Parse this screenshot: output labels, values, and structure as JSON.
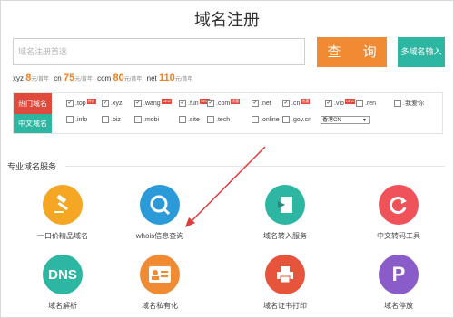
{
  "title": "域名注册",
  "search": {
    "placeholder": "域名注册首选"
  },
  "buttons": {
    "query": "查 询",
    "multi": "多域名输入"
  },
  "prices": [
    {
      "ext": "xyz",
      "price": "8",
      "unit": "元/首年"
    },
    {
      "ext": "cn",
      "price": "75",
      "unit": "元/首年"
    },
    {
      "ext": "com",
      "price": "80",
      "unit": "元/首年"
    },
    {
      "ext": "net",
      "price": "110",
      "unit": "元/首年"
    }
  ],
  "categories": {
    "hot": "热门域名",
    "chinese": "中文域名"
  },
  "options_row1": [
    {
      "label": ".top",
      "checked": true,
      "tag": "特价"
    },
    {
      "label": ".xyz",
      "checked": true,
      "tag": ""
    },
    {
      "label": ".wang",
      "checked": true,
      "tag": "NEW"
    },
    {
      "label": ".fun",
      "checked": true,
      "tag": "NEW"
    },
    {
      "label": ".com",
      "checked": true,
      "tag": "优惠"
    },
    {
      "label": ".net",
      "checked": true,
      "tag": ""
    },
    {
      "label": ".cn",
      "checked": true,
      "tag": "优惠"
    },
    {
      "label": ".vip",
      "checked": true,
      "tag": "NEW"
    },
    {
      "label": ".ren",
      "checked": false,
      "tag": ""
    },
    {
      "label": ".我爱你",
      "checked": false,
      "tag": ""
    }
  ],
  "options_row2": [
    {
      "label": ".info",
      "checked": false
    },
    {
      "label": ".biz",
      "checked": false
    },
    {
      "label": ".mobi",
      "checked": false
    },
    {
      "label": ".site",
      "checked": false
    },
    {
      "label": ".tech",
      "checked": false
    },
    {
      "label": ".online",
      "checked": false
    },
    {
      "label": ".gov.cn",
      "checked": false
    }
  ],
  "select": {
    "value": "香港CN"
  },
  "section": {
    "title": "专业域名服务"
  },
  "services": [
    {
      "label": "一口价精品域名",
      "color": "#f5a623",
      "icon": "gavel-icon"
    },
    {
      "label": "whois信息查询",
      "color": "#2a9ad8",
      "icon": "search-icon"
    },
    {
      "label": "域名转入服务",
      "color": "#2db7a2",
      "icon": "transfer-icon"
    },
    {
      "label": "中文转码工具",
      "color": "#f0525a",
      "icon": "refresh-icon"
    },
    {
      "label": "域名解析",
      "color": "#2db7a2",
      "icon": "dns-icon",
      "text": "DNS"
    },
    {
      "label": "域名私有化",
      "color": "#f08a33",
      "icon": "id-card-icon"
    },
    {
      "label": "域名证书打印",
      "color": "#e5543b",
      "icon": "printer-icon"
    },
    {
      "label": "域名停放",
      "color": "#8a5cc9",
      "icon": "parking-icon",
      "text": "P"
    }
  ],
  "colors": {
    "accent": "#f08a33",
    "teal": "#2db7a2",
    "red": "#e04a3c",
    "arrow": "#e03a3a"
  }
}
